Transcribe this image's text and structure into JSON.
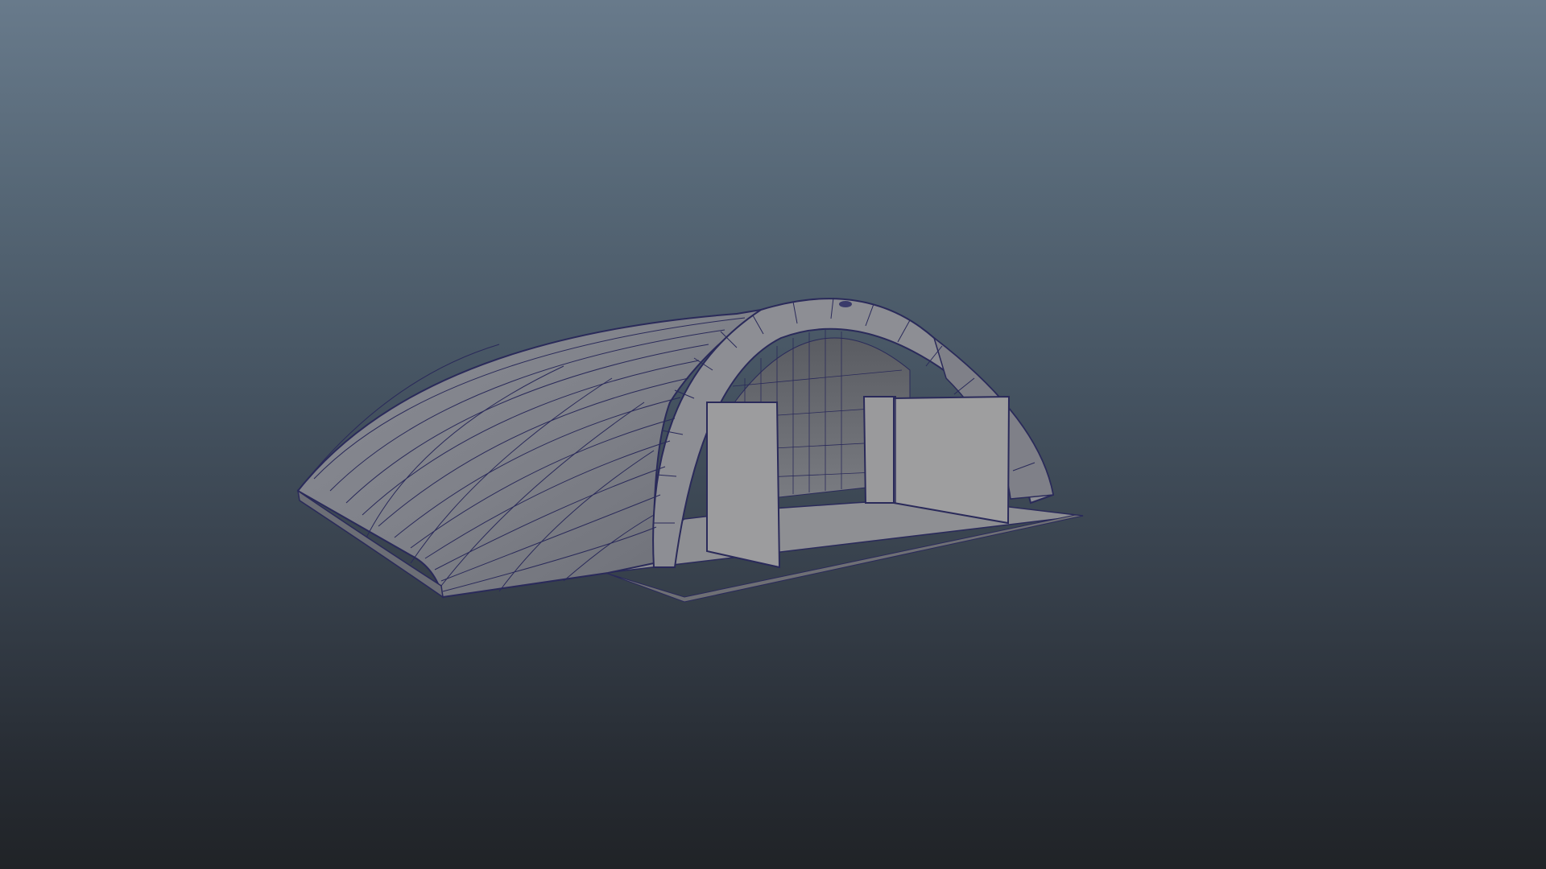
{
  "viewport": {
    "label": "",
    "background_top": "#687a8b",
    "background_bottom": "#202327"
  },
  "model": {
    "subject": "quonset-hangar-wireframe",
    "shaded_color": "#9a9a9a",
    "wire_color": "#2a2a5a"
  }
}
